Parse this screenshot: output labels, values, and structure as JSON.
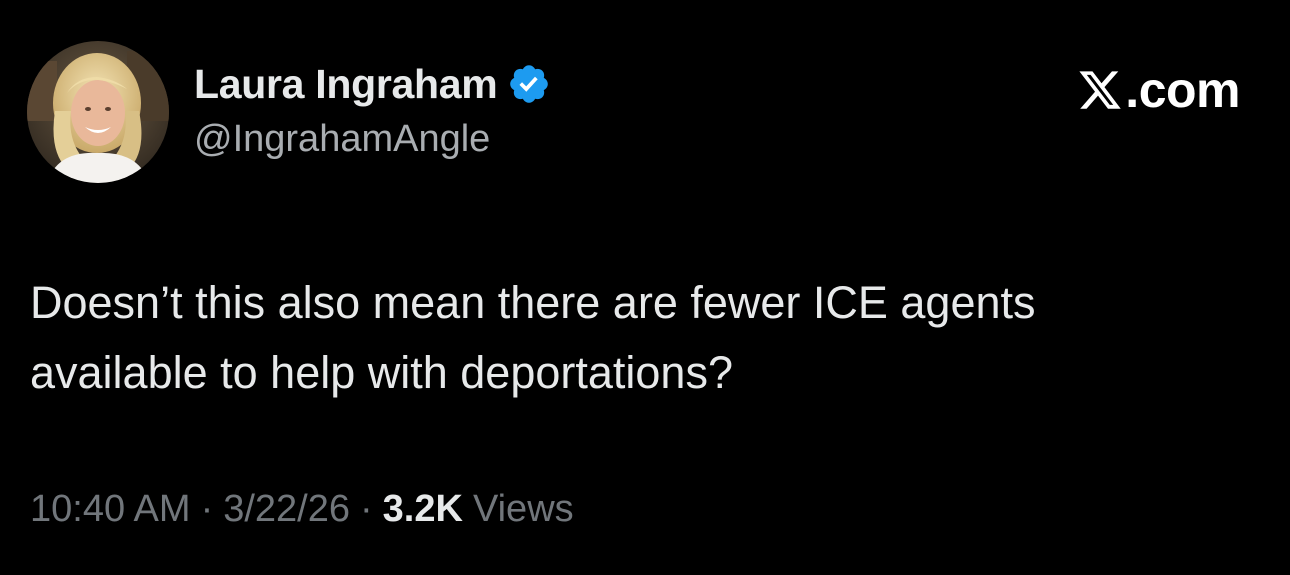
{
  "author": {
    "display_name": "Laura Ingraham",
    "handle": "@IngrahamAngle",
    "verified": true,
    "avatar_icon": "profile-photo"
  },
  "brand": {
    "logo_icon": "x-logo-icon",
    "text": ".com"
  },
  "tweet": {
    "text": "Doesn’t this also mean there are fewer ICE agents\navailable to help with deportations?"
  },
  "meta": {
    "time": "10:40 AM",
    "separator": "·",
    "date": "3/22/26",
    "views_count": "3.2K",
    "views_label": "Views"
  },
  "colors": {
    "background": "#000000",
    "primary_text": "#e7e9ea",
    "secondary_text": "#71767b",
    "verified_blue": "#1d9bf0"
  }
}
